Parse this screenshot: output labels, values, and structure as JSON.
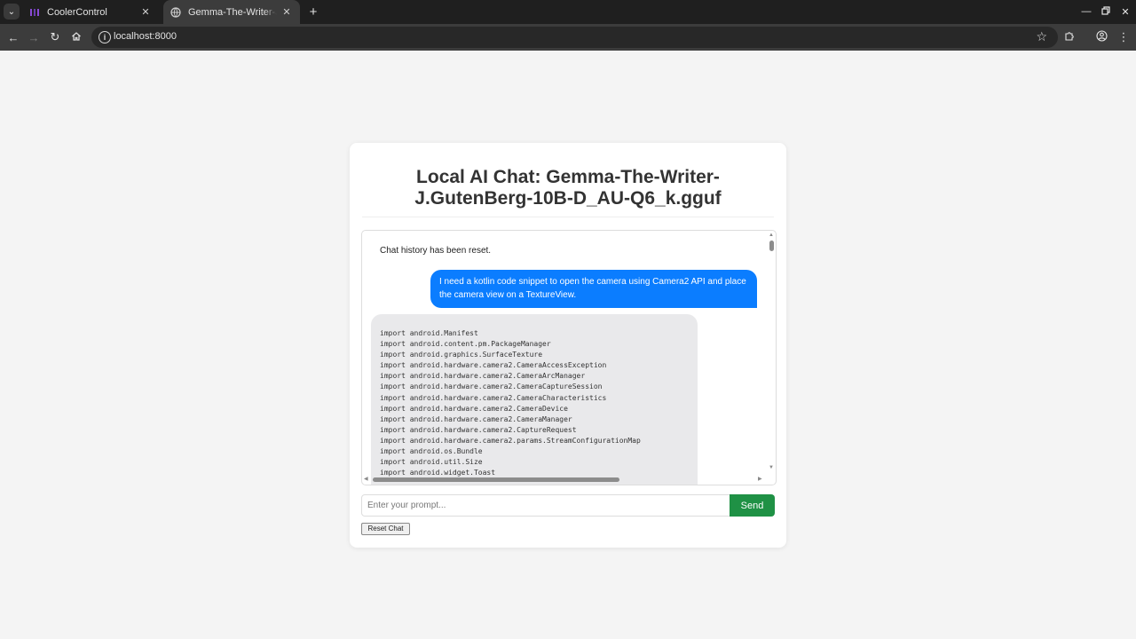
{
  "browser": {
    "tabs": [
      {
        "title": "CoolerControl",
        "active": false,
        "icon": "coolercontrol-icon"
      },
      {
        "title": "Gemma-The-Writer-J.GutenBerg-10B-D_AU-Q6_k.gguf",
        "active": true,
        "icon": "globe-icon"
      }
    ],
    "url": "localhost:8000"
  },
  "page": {
    "title": "Local AI Chat: Gemma-The-Writer-J.GutenBerg-10B-D_AU-Q6_k.gguf",
    "messages": {
      "system": "Chat history has been reset.",
      "user": "I need a kotlin code snippet to open the camera using Camera2 API and place the camera view on a TextureView.",
      "bot_code_lines": [
        "import android.Manifest",
        "import android.content.pm.PackageManager",
        "import android.graphics.SurfaceTexture",
        "import android.hardware.camera2.CameraAccessException",
        "import android.hardware.camera2.CameraArcManager",
        "import android.hardware.camera2.CameraCaptureSession",
        "import android.hardware.camera2.CameraCharacteristics",
        "import android.hardware.camera2.CameraDevice",
        "import android.hardware.camera2.CameraManager",
        "import android.hardware.camera2.CaptureRequest",
        "import android.hardware.camera2.params.StreamConfigurationMap",
        "import android.os.Bundle",
        "import android.util.Size",
        "import android.widget.Toast"
      ]
    },
    "prompt_placeholder": "Enter your prompt...",
    "send_label": "Send",
    "reset_label": "Reset Chat"
  },
  "colors": {
    "user_bubble": "#0b7dff",
    "bot_bubble": "#e9e9eb",
    "send_button": "#1f9145",
    "page_background": "#f4f4f4"
  }
}
